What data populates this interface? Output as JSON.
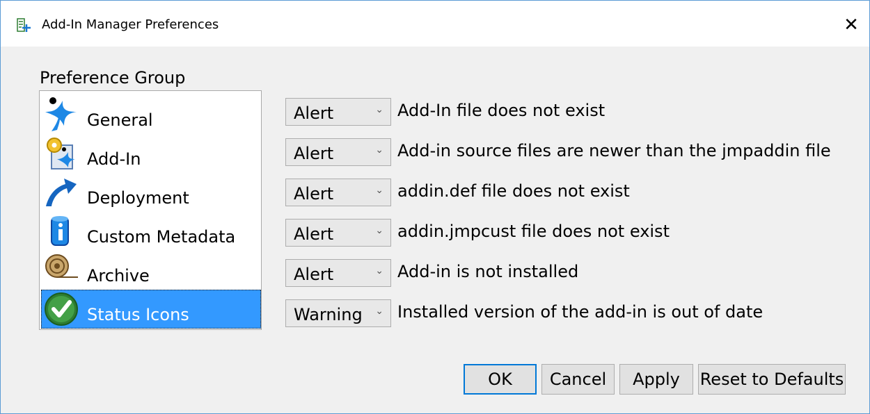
{
  "window": {
    "title": "Add-In Manager Preferences",
    "close_glyph": "✕"
  },
  "preference_group": {
    "label": "Preference Group",
    "items": [
      {
        "label": "General",
        "icon": "general-star-icon",
        "selected": false
      },
      {
        "label": "Add-In",
        "icon": "addin-gear-icon",
        "selected": false
      },
      {
        "label": "Deployment",
        "icon": "deployment-arrow-icon",
        "selected": false
      },
      {
        "label": "Custom Metadata",
        "icon": "info-icon",
        "selected": false
      },
      {
        "label": "Archive",
        "icon": "archive-roll-icon",
        "selected": false
      },
      {
        "label": "Status Icons",
        "icon": "check-circle-icon",
        "selected": true
      }
    ]
  },
  "rules": [
    {
      "value": "Alert",
      "description": "Add-In file does not exist"
    },
    {
      "value": "Alert",
      "description": "Add-in source files are newer than the jmpaddin file"
    },
    {
      "value": "Alert",
      "description": "addin.def file does not exist"
    },
    {
      "value": "Alert",
      "description": "addin.jmpcust file does not exist"
    },
    {
      "value": "Alert",
      "description": "Add-in is not installed"
    },
    {
      "value": "Warning",
      "description": "Installed version of the add-in is out of date"
    }
  ],
  "dropdown_arrow": "⌄",
  "buttons": {
    "ok": "OK",
    "cancel": "Cancel",
    "apply": "Apply",
    "reset": "Reset to Defaults"
  },
  "colors": {
    "selection": "#3399ff",
    "window_border": "#5b9bd5",
    "default_button_border": "#0078d7"
  }
}
